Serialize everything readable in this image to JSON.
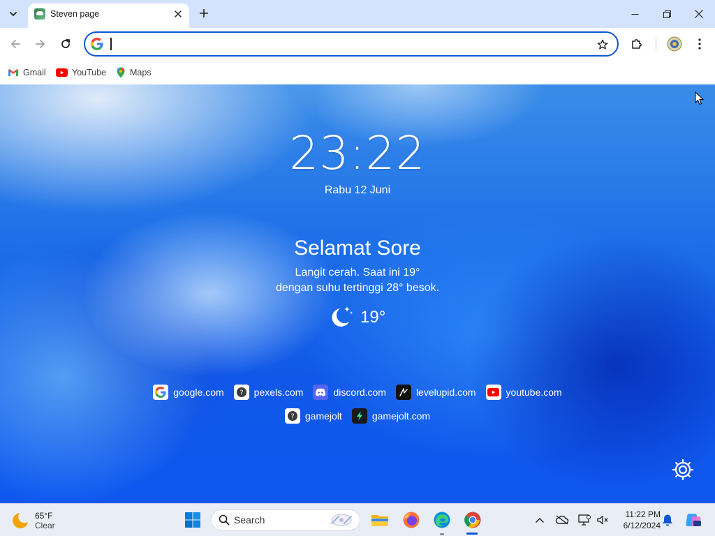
{
  "browser": {
    "tab": {
      "title": "Steven page"
    },
    "omnibox": {
      "value": "",
      "placeholder": ""
    },
    "bookmarks": [
      {
        "label": "Gmail",
        "icon": "gmail-icon"
      },
      {
        "label": "YouTube",
        "icon": "youtube-icon"
      },
      {
        "label": "Maps",
        "icon": "maps-icon"
      }
    ]
  },
  "page": {
    "time": "23:22",
    "date": "Rabu 12 Juni",
    "greeting": "Selamat Sore",
    "weather_line1": "Langit cerah. Saat ini 19°",
    "weather_line2": "dengan suhu tertinggi 28° besok.",
    "weather_temp": "19°",
    "weather_icon": "moon-stars-icon",
    "shortcuts_row1": [
      {
        "label": "google.com",
        "icon": "google-icon"
      },
      {
        "label": "pexels.com",
        "icon": "unknown-site-icon"
      },
      {
        "label": "discord.com",
        "icon": "discord-icon"
      },
      {
        "label": "levelupid.com",
        "icon": "levelupid-icon"
      },
      {
        "label": "youtube.com",
        "icon": "youtube-icon"
      }
    ],
    "shortcuts_row2": [
      {
        "label": "gamejolt",
        "icon": "unknown-site-icon"
      },
      {
        "label": "gamejolt.com",
        "icon": "gamejolt-icon"
      }
    ]
  },
  "taskbar": {
    "weather_temp": "65°F",
    "weather_condition": "Clear",
    "search_label": "Search",
    "time": "11:22 PM",
    "date": "6/12/2024"
  },
  "colors": {
    "accent": "#0b57d0",
    "tabstrip": "#d3e3fd",
    "page_blue": "#1158e8"
  }
}
